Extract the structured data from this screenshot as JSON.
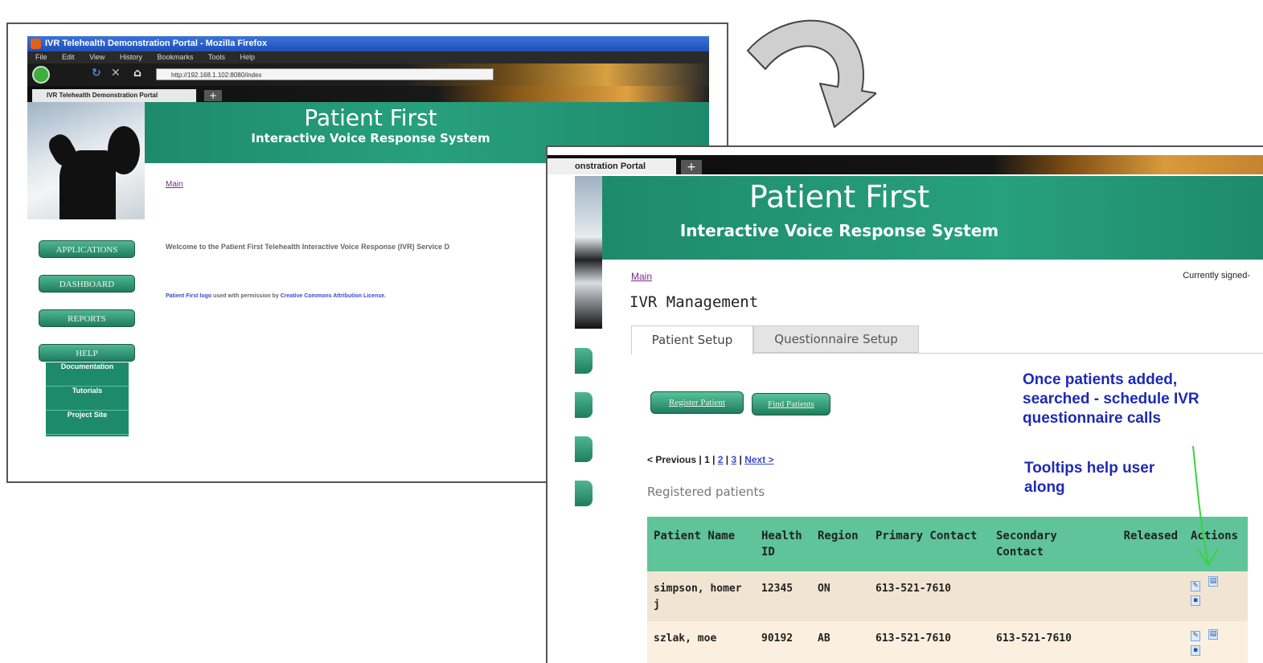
{
  "back_window": {
    "title": "IVR Telehealth Demonstration Portal - Mozilla Firefox",
    "menu": [
      "File",
      "Edit",
      "View",
      "History",
      "Bookmarks",
      "Tools",
      "Help"
    ],
    "url": "http://192.168.1.102:8080/index",
    "tab_label": "IVR Telehealth Demonstration Portal",
    "banner_title": "Patient First",
    "banner_subtitle": "Interactive Voice Response System",
    "main_link": "Main",
    "welcome_text": "Welcome to the Patient First Telehealth Interactive Voice Response (IVR) Service D",
    "credit_prefix": "Patient First logo",
    "credit_middle": " used with permission by ",
    "credit_link": "Creative Commons Attribution License.",
    "nav_buttons": [
      "APPLICATIONS",
      "DASHBOARD",
      "REPORTS",
      "HELP"
    ],
    "help_items": [
      "Documentation",
      "Tutorials",
      "Project Site"
    ]
  },
  "front_window": {
    "tab_label": "onstration Portal",
    "banner_title": "Patient First",
    "banner_subtitle": "Interactive Voice Response System",
    "main_link": "Main",
    "signed_in": "Currently signed-",
    "page_title": "IVR Management",
    "tabs": [
      "Patient Setup",
      "Questionnaire Setup"
    ],
    "buttons": [
      "Register Patient",
      "Find Patients"
    ],
    "pager": {
      "prev": "< Previous",
      "sep": " | ",
      "current": "1",
      "pages": [
        "2",
        "3"
      ],
      "next": "Next >"
    },
    "section_label": "Registered patients",
    "table": {
      "headers": [
        "Patient Name",
        "Health ID",
        "Region",
        "Primary Contact",
        "Secondary Contact",
        "Released",
        "Actions"
      ],
      "rows": [
        [
          "simpson, homer j",
          "12345",
          "ON",
          "613-521-7610",
          "",
          ""
        ],
        [
          "szlak, moe",
          "90192",
          "AB",
          "613-521-7610",
          "613-521-7610",
          ""
        ]
      ]
    }
  },
  "annotations": {
    "note1": [
      "Once patients added,",
      "searched - schedule IVR",
      "questionnaire calls"
    ],
    "note2": [
      "Tooltips help user",
      "along"
    ]
  },
  "colors": {
    "banner_green": "#1e8a6c",
    "table_header": "#5fc49a",
    "annotation_blue": "#1e2ab4",
    "callout_green": "#3ad43a"
  }
}
